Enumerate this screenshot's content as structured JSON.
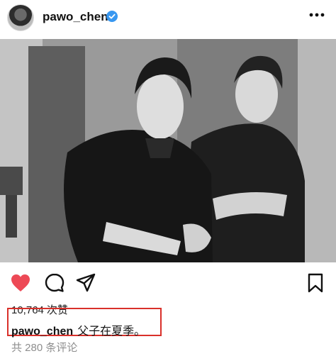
{
  "header": {
    "username": "pawo_chen",
    "avatar_icon": "profile-avatar",
    "verified_icon": "verified-badge-icon",
    "more_icon": "more-options-icon"
  },
  "photo": {
    "icon": "post-photo"
  },
  "actions": {
    "like_icon": "heart-icon",
    "like_color": "#ed4956",
    "comment_icon": "comment-icon",
    "share_icon": "send-icon",
    "save_icon": "bookmark-icon"
  },
  "post": {
    "likes": "10,764 次赞",
    "caption_user": "pawo_chen",
    "caption_text": "父子在夏季。",
    "comments": "共 280 条评论",
    "highlight_color": "#d9302a"
  }
}
